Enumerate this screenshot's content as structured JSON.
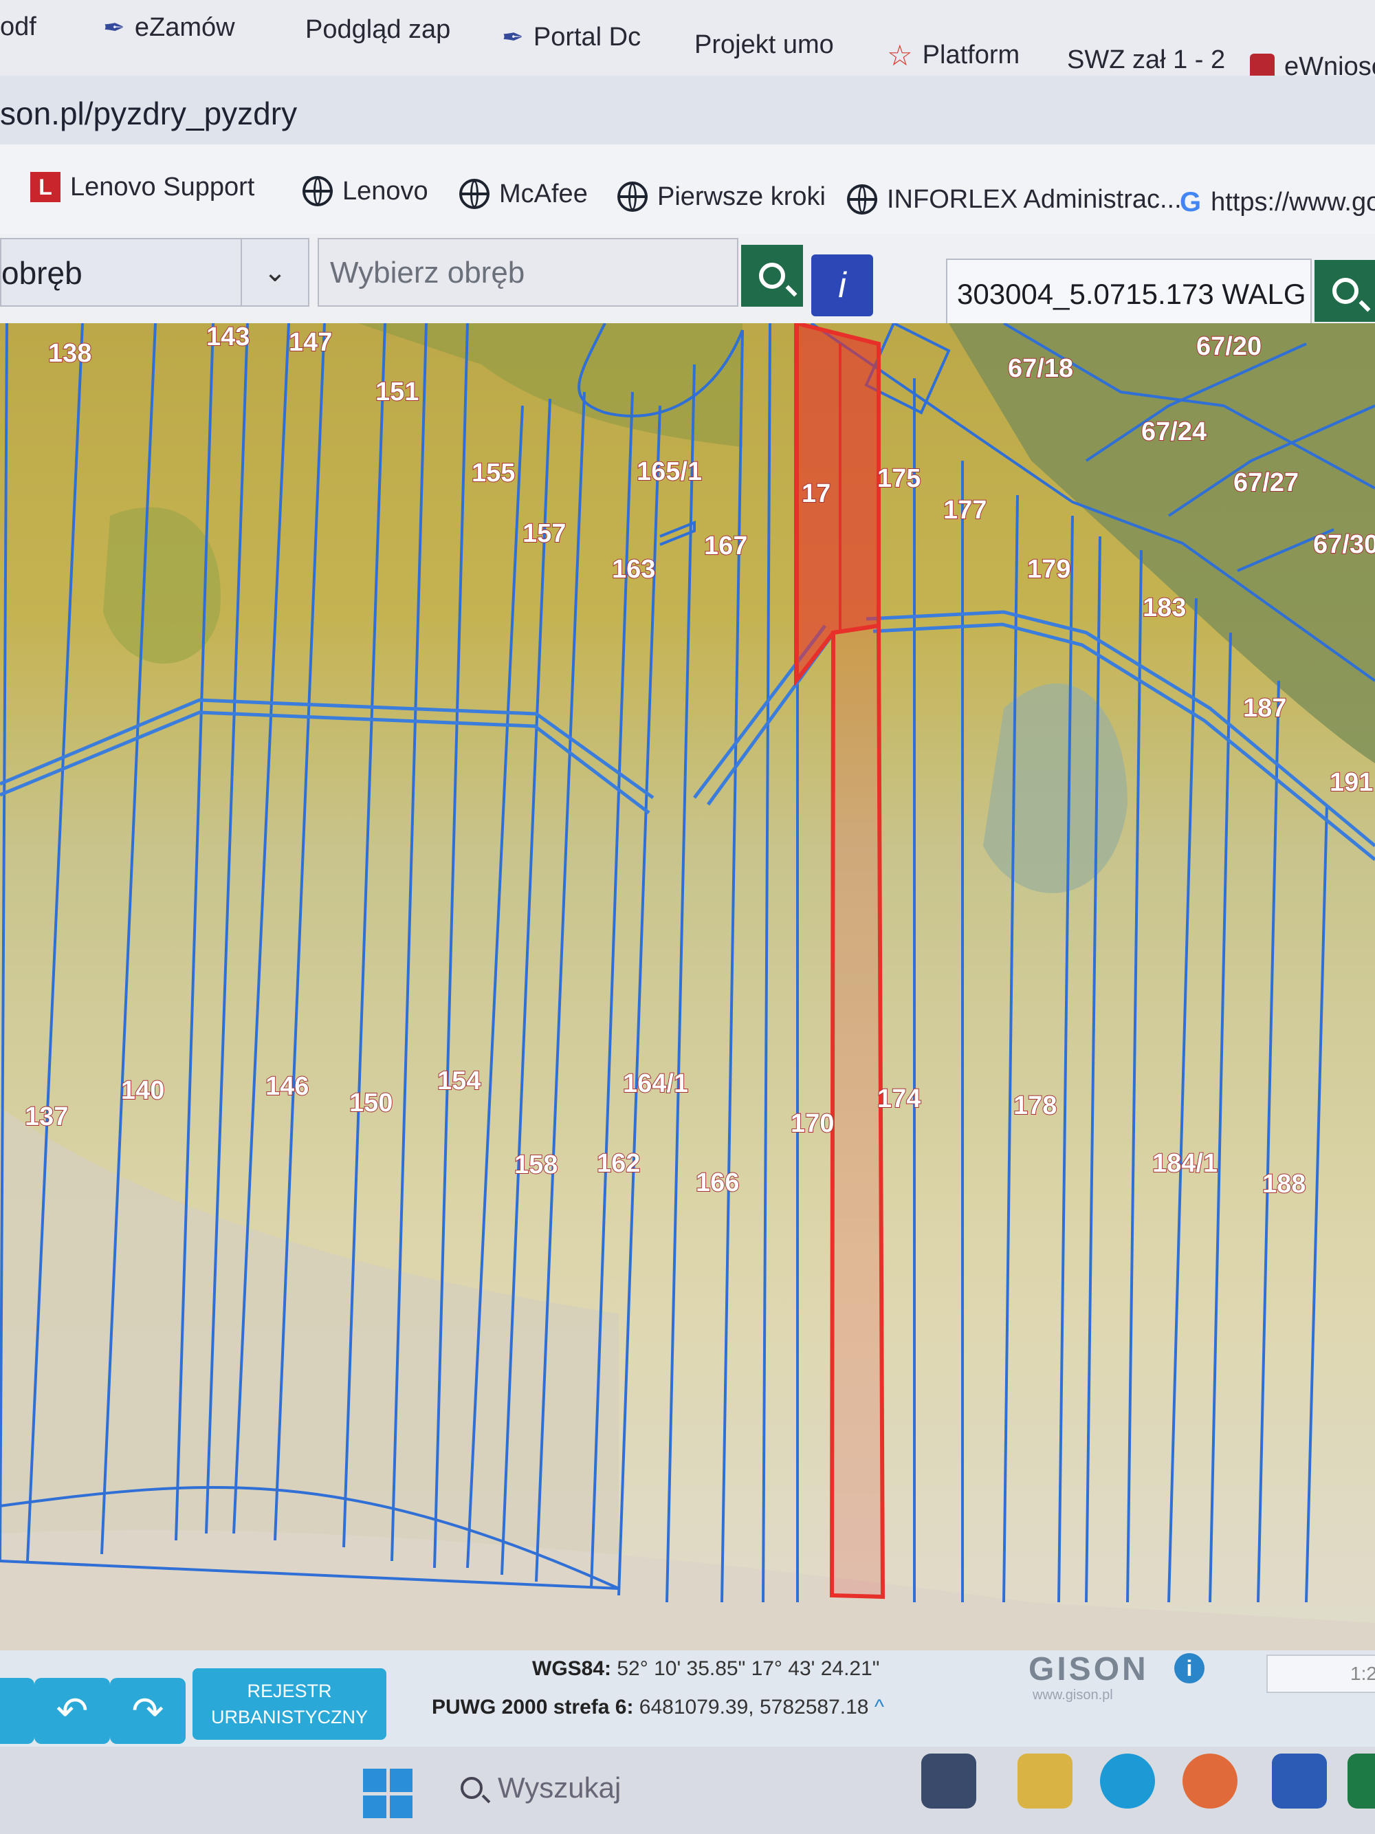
{
  "bookmarks_top": [
    {
      "label": "odf",
      "icon": "none"
    },
    {
      "label": "eZamów",
      "icon": "feather-icon"
    },
    {
      "label": "Podgląd zap",
      "icon": "none"
    },
    {
      "label": "Portal Dc",
      "icon": "feather-icon"
    },
    {
      "label": "Projekt umo",
      "icon": "none"
    },
    {
      "label": "Platform",
      "icon": "star-icon"
    },
    {
      "label": "SWZ zał 1 - 2",
      "icon": "none"
    },
    {
      "label": "eWniose",
      "icon": "government-crest-icon"
    }
  ],
  "address_bar": {
    "url": "son.pl/pyzdry_pyzdry"
  },
  "bookmarks_bar": [
    {
      "label": "Lenovo Support",
      "icon": "lenovo-icon"
    },
    {
      "label": "Lenovo",
      "icon": "globe-icon"
    },
    {
      "label": "McAfee",
      "icon": "globe-icon"
    },
    {
      "label": "Pierwsze kroki",
      "icon": "globe-icon"
    },
    {
      "label": "INFORLEX Administrac...",
      "icon": "globe-icon"
    },
    {
      "label": "https://www.go",
      "icon": "google-icon"
    }
  ],
  "toolbar": {
    "select_label": "obręb",
    "precinct_placeholder": "Wybierz obręb",
    "parcel_value": "303004_5.0715.173 WALG"
  },
  "map": {
    "highlight_color": "#e8302a",
    "line_color": "#2f6fd6",
    "parcel_labels": [
      {
        "id": "p138",
        "text": "138"
      },
      {
        "id": "p143",
        "text": "143"
      },
      {
        "id": "p147",
        "text": "147"
      },
      {
        "id": "p151",
        "text": "151"
      },
      {
        "id": "p155",
        "text": "155"
      },
      {
        "id": "p157",
        "text": "157"
      },
      {
        "id": "p1651",
        "text": "165/1"
      },
      {
        "id": "p163",
        "text": "163"
      },
      {
        "id": "p167",
        "text": "167"
      },
      {
        "id": "p17x",
        "text": "17"
      },
      {
        "id": "p175",
        "text": "175"
      },
      {
        "id": "p177",
        "text": "177"
      },
      {
        "id": "p179",
        "text": "179"
      },
      {
        "id": "p183",
        "text": "183"
      },
      {
        "id": "p187",
        "text": "187"
      },
      {
        "id": "p191",
        "text": "191"
      },
      {
        "id": "p6718",
        "text": "67/18"
      },
      {
        "id": "p6720",
        "text": "67/20"
      },
      {
        "id": "p6724",
        "text": "67/24"
      },
      {
        "id": "p6727",
        "text": "67/27"
      },
      {
        "id": "p6730",
        "text": "67/30"
      },
      {
        "id": "p137",
        "text": "137"
      },
      {
        "id": "p140",
        "text": "140"
      },
      {
        "id": "p146",
        "text": "146"
      },
      {
        "id": "p150",
        "text": "150"
      },
      {
        "id": "p154",
        "text": "154"
      },
      {
        "id": "p1641",
        "text": "164/1"
      },
      {
        "id": "p158",
        "text": "158"
      },
      {
        "id": "p162",
        "text": "162"
      },
      {
        "id": "p166",
        "text": "166"
      },
      {
        "id": "p170",
        "text": "170"
      },
      {
        "id": "p174",
        "text": "174"
      },
      {
        "id": "p178",
        "text": "178"
      },
      {
        "id": "p1841",
        "text": "184/1"
      },
      {
        "id": "p188",
        "text": "188"
      }
    ]
  },
  "statusbar": {
    "undo_icon": "undo-icon",
    "redo_icon": "redo-icon",
    "rejestr_line1": "REJESTR",
    "rejestr_line2": "URBANISTYCZNY",
    "wgs_label": "WGS84:",
    "wgs_value": "52° 10' 35.85\" 17° 43' 24.21\"",
    "puwg_label": "PUWG 2000 strefa 6:",
    "puwg_value": "6481079.39, 5782587.18",
    "brand": "GISON",
    "brand_url": "www.gison.pl",
    "scale_value": "1:2"
  },
  "taskbar": {
    "search_placeholder": "Wyszukaj"
  }
}
